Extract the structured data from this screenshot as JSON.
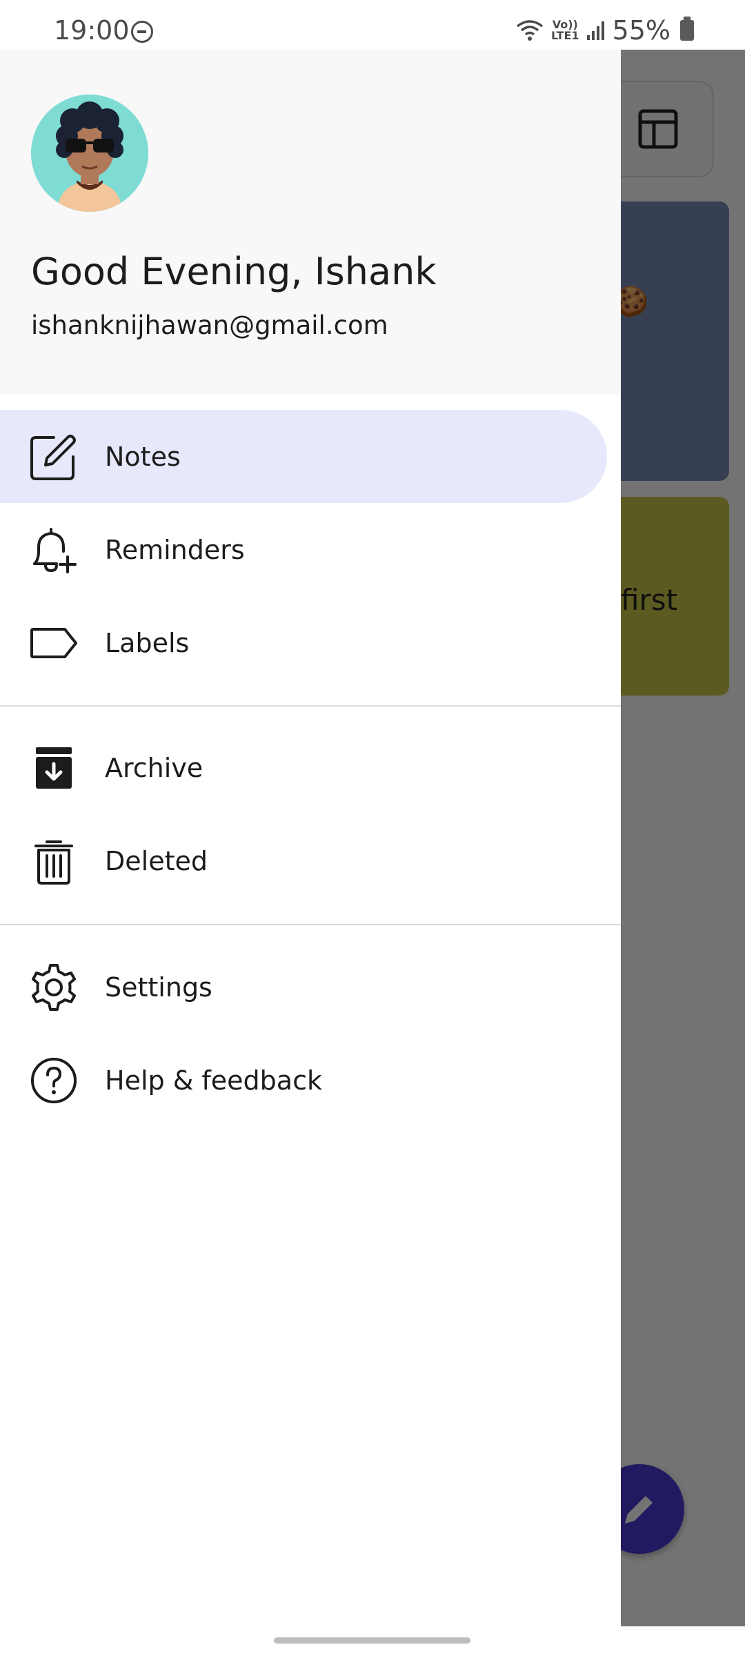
{
  "status_bar": {
    "time": "19:00",
    "network": "VoLTE1",
    "network_line1": "Vo))",
    "network_line2": "LTE1",
    "battery": "55%",
    "icons": [
      "do-not-disturb-icon",
      "wifi-icon",
      "cell-signal-icon",
      "battery-icon"
    ]
  },
  "background": {
    "note_card_text": "first",
    "note_card_emoji": "🍪",
    "colors": {
      "card1": "#7a8fb8",
      "card2": "#c9c74a",
      "fab": "#4a3bd8"
    }
  },
  "drawer": {
    "greeting": "Good Evening, Ishank",
    "email": "ishanknijhawan@gmail.com",
    "avatar": "avatar-sunglasses",
    "accent_color": "#e8e8fd",
    "items": [
      {
        "label": "Notes",
        "icon": "edit-note-icon",
        "active": true
      },
      {
        "label": "Reminders",
        "icon": "bell-plus-icon",
        "active": false
      },
      {
        "label": "Labels",
        "icon": "label-icon",
        "active": false
      },
      {
        "label": "Archive",
        "icon": "archive-icon",
        "active": false
      },
      {
        "label": "Deleted",
        "icon": "trash-icon",
        "active": false
      },
      {
        "label": "Settings",
        "icon": "gear-icon",
        "active": false
      },
      {
        "label": "Help & feedback",
        "icon": "help-icon",
        "active": false
      }
    ]
  }
}
